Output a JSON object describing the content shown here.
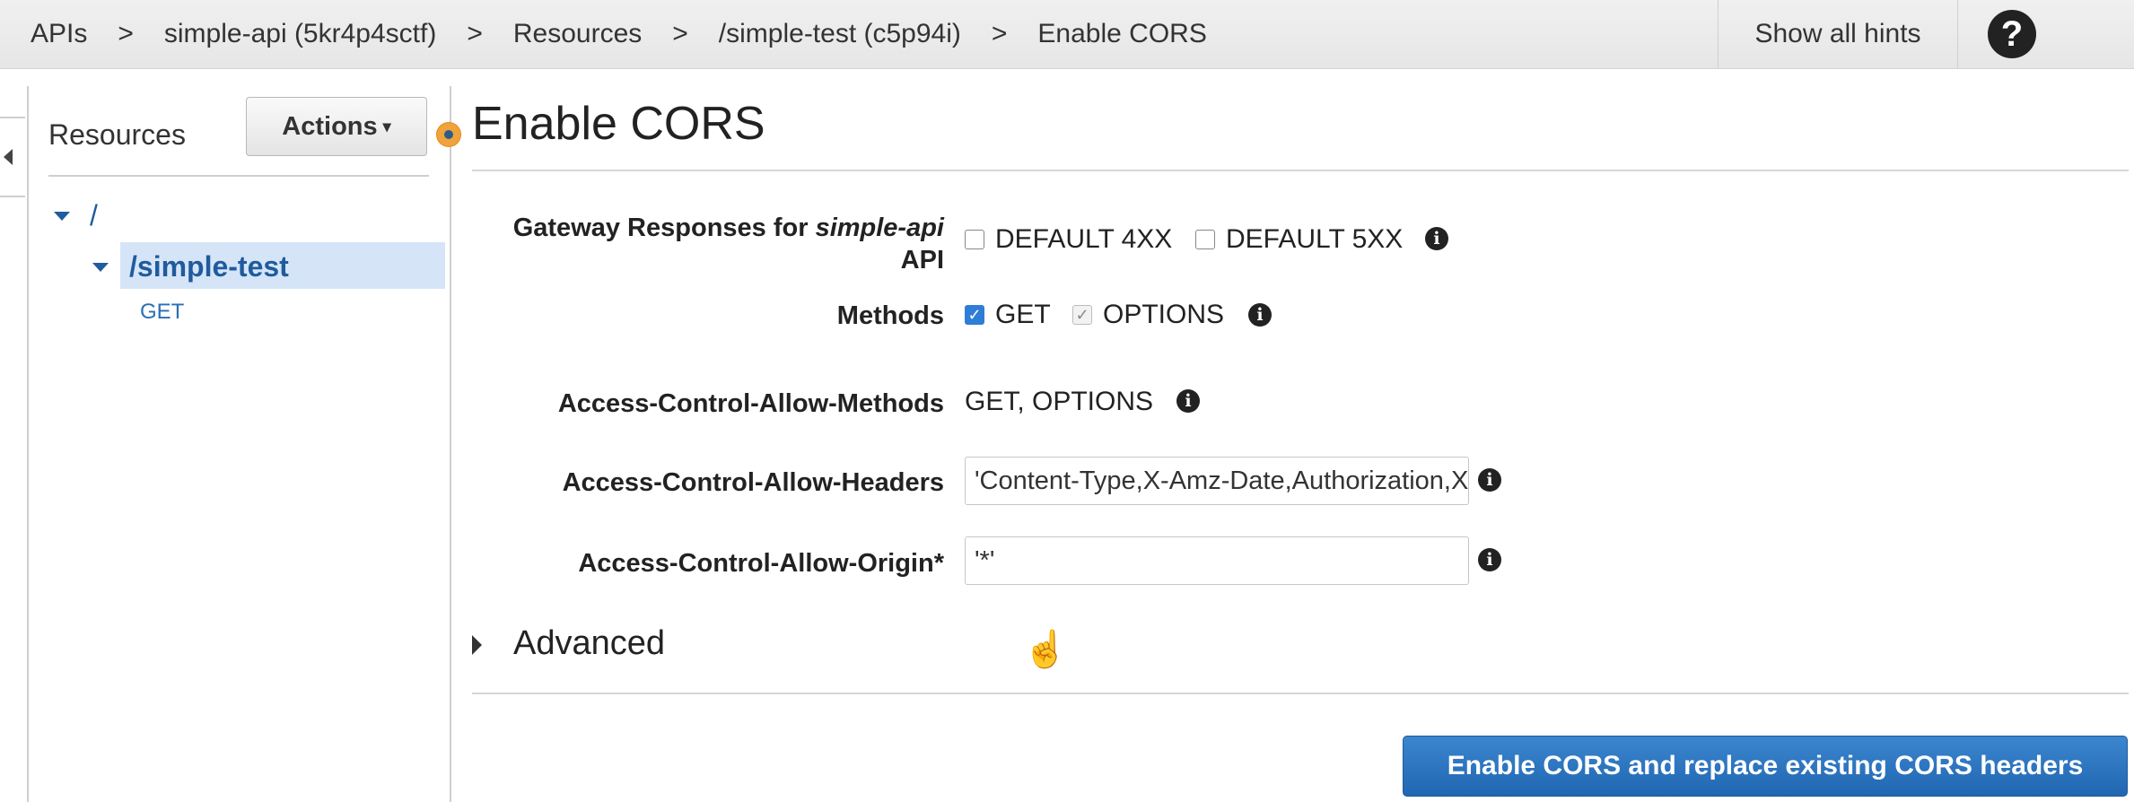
{
  "breadcrumb": {
    "items": [
      "APIs",
      "simple-api (5kr4p4sctf)",
      "Resources",
      "/simple-test (c5p94i)",
      "Enable CORS"
    ],
    "separator": ">"
  },
  "header": {
    "hints_label": "Show all hints",
    "help_symbol": "?"
  },
  "sidebar": {
    "title": "Resources",
    "actions_label": "Actions",
    "tree": {
      "root": "/",
      "selected": "/simple-test",
      "method": "GET"
    }
  },
  "main": {
    "title": "Enable CORS",
    "gateway": {
      "label_prefix": "Gateway Responses for ",
      "label_api": "simple-api",
      "label_suffix": "API",
      "opt1": "DEFAULT 4XX",
      "opt2": "DEFAULT 5XX"
    },
    "methods": {
      "label": "Methods",
      "get": "GET",
      "options": "OPTIONS",
      "get_checked": true,
      "options_checked": true
    },
    "acam": {
      "label": "Access-Control-Allow-Methods",
      "value": "GET, OPTIONS"
    },
    "acah": {
      "label": "Access-Control-Allow-Headers",
      "value": "'Content-Type,X-Amz-Date,Authorization,X-Api-Key,X-Amz-Security-Token'"
    },
    "acao": {
      "label": "Access-Control-Allow-Origin*",
      "value": "'*'"
    },
    "advanced_label": "Advanced",
    "enable_button": "Enable CORS and replace existing CORS headers"
  },
  "icons": {
    "info": "info-icon",
    "help": "help-icon",
    "cursor": "hand-pointer-icon"
  },
  "colors": {
    "link_blue": "#1f5b9e",
    "selection_bg": "#d5e5f7",
    "button_blue": "#2166b1",
    "accent_orange": "#f0a23c"
  }
}
